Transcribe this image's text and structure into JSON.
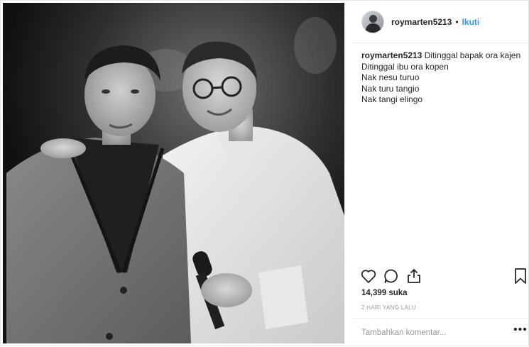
{
  "header": {
    "username": "roymarten5213",
    "separator": "•",
    "follow_label": "Ikuti"
  },
  "caption": {
    "username": "roymarten5213",
    "lines": [
      "Ditinggal bapak ora kajen",
      "Ditinggal ibu ora kopen",
      "Nak nesu turuo",
      "Nak turu tangio",
      "Nak tangi elingo"
    ]
  },
  "actions": {
    "like_icon": "heart-icon",
    "comment_icon": "comment-icon",
    "share_icon": "share-icon",
    "save_icon": "bookmark-icon"
  },
  "likes": "14,399 suka",
  "timestamp": "2 HARI YANG LALU",
  "comment": {
    "placeholder": "Tambahkan komentar...",
    "more_label": "•••"
  },
  "colors": {
    "link": "#3897f0",
    "text": "#262626",
    "muted": "#999999",
    "border": "#efefef"
  }
}
